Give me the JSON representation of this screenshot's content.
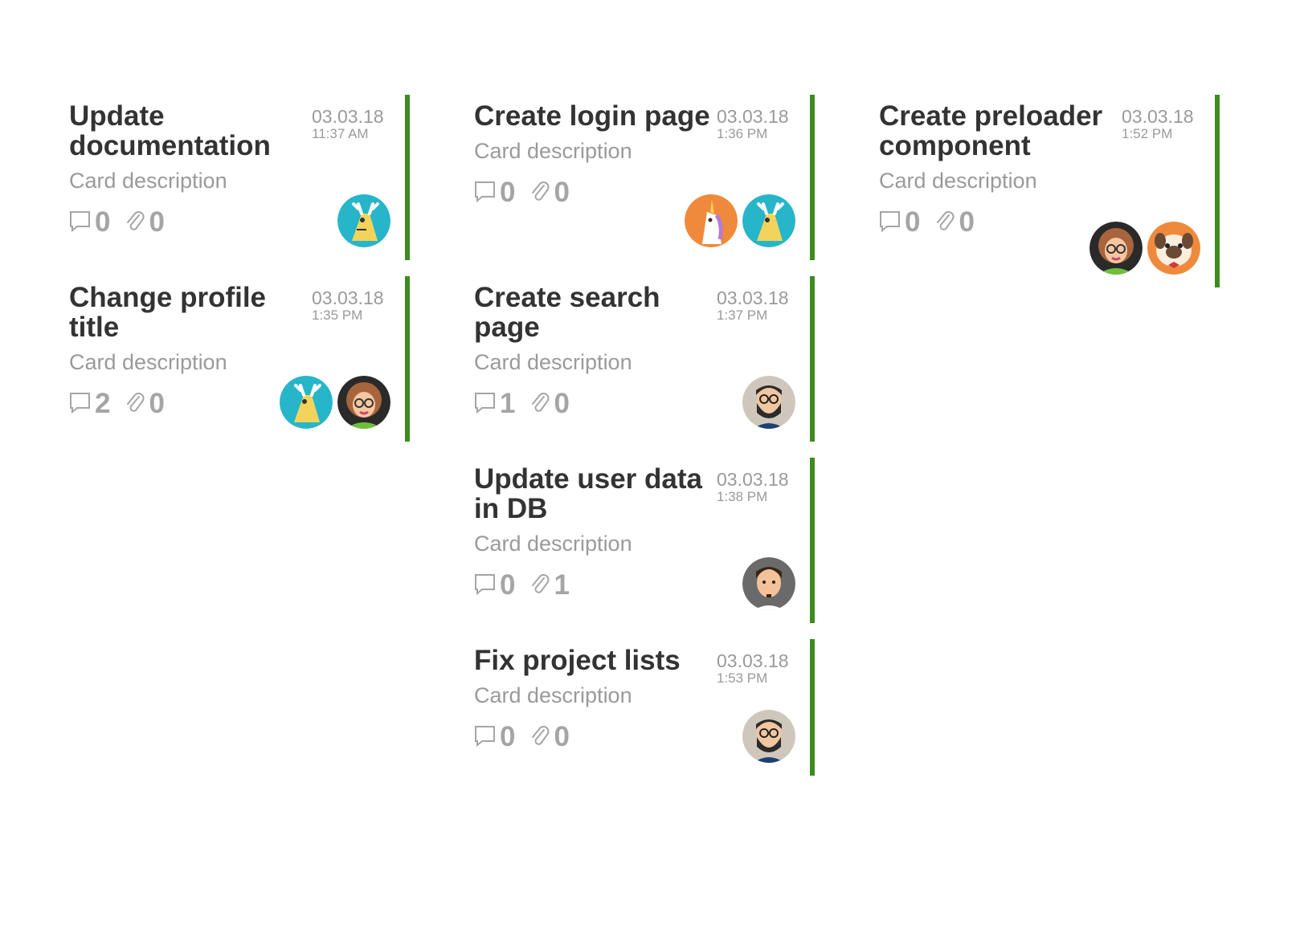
{
  "columns": [
    {
      "cards": [
        {
          "title": "Update documentation",
          "description": "Card description",
          "date": "03.03.18",
          "time": "11:37 AM",
          "comments": "0",
          "attachments": "0",
          "avatars": [
            "moose"
          ]
        },
        {
          "title": "Change profile title",
          "description": "Card description",
          "date": "03.03.18",
          "time": "1:35 PM",
          "comments": "2",
          "attachments": "0",
          "avatars": [
            "moose",
            "woman-glasses"
          ]
        }
      ]
    },
    {
      "cards": [
        {
          "title": "Create login page",
          "description": "Card description",
          "date": "03.03.18",
          "time": "1:36 PM",
          "comments": "0",
          "attachments": "0",
          "avatars": [
            "unicorn",
            "moose"
          ]
        },
        {
          "title": "Create search page",
          "description": "Card description",
          "date": "03.03.18",
          "time": "1:37 PM",
          "comments": "1",
          "attachments": "0",
          "avatars": [
            "bearded-man"
          ]
        },
        {
          "title": "Update user data in DB",
          "description": "Card description",
          "date": "03.03.18",
          "time": "1:38 PM",
          "comments": "0",
          "attachments": "1",
          "avatars": [
            "man-goatee"
          ]
        },
        {
          "title": "Fix project lists",
          "description": "Card description",
          "date": "03.03.18",
          "time": "1:53 PM",
          "comments": "0",
          "attachments": "0",
          "avatars": [
            "bearded-man"
          ]
        }
      ]
    },
    {
      "cards": [
        {
          "title": "Create preloader component",
          "description": "Card description",
          "date": "03.03.18",
          "time": "1:52 PM",
          "comments": "0",
          "attachments": "0",
          "avatars": [
            "woman-glasses",
            "pug"
          ]
        }
      ]
    }
  ],
  "colors": {
    "accent": "#3d8b1f",
    "title": "#333333",
    "muted": "#9a9a9a"
  }
}
